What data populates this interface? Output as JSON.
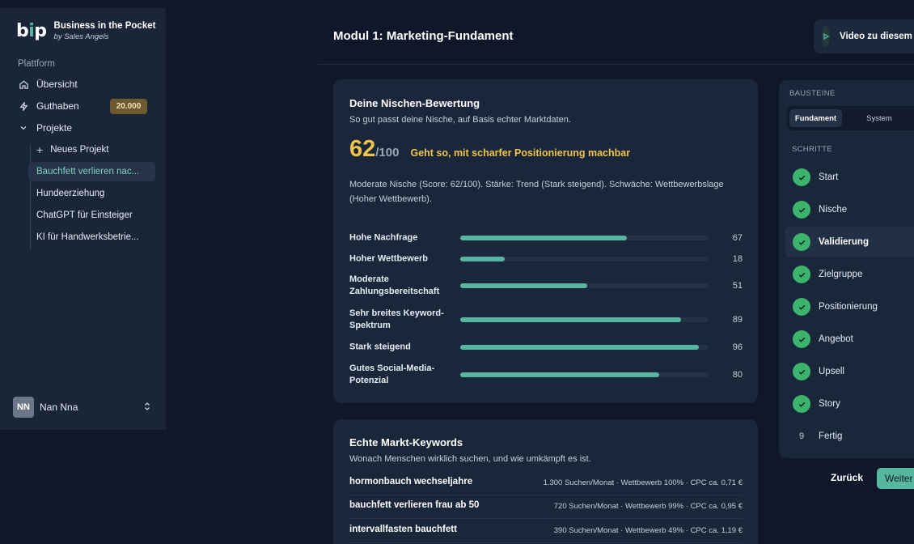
{
  "brand": {
    "mark_b": "b",
    "mark_i": "i",
    "mark_p": "p",
    "title": "Business in the Pocket",
    "subtitle": "by Sales Angels"
  },
  "sidebar": {
    "section": "Plattform",
    "overview": "Übersicht",
    "credits": "Guthaben",
    "credits_badge": "20.000",
    "projects": "Projekte",
    "new_project": "Neues Projekt",
    "project_items": [
      "Bauchfett verlieren nac...",
      "Hundeerziehung",
      "ChatGPT für Einsteiger",
      "KI für Handwerksbetrie..."
    ],
    "user_initials": "NN",
    "user_name": "Nan Nna"
  },
  "header": {
    "title": "Modul 1: Marketing-Fundament",
    "video_button": "Video zu diesem Modul"
  },
  "niche": {
    "title": "Deine Nischen-Bewertung",
    "subtitle": "So gut passt deine Nische, auf Basis echter Marktdaten.",
    "score": "62",
    "score_max": "/100",
    "verdict": "Geht so, mit scharfer Positionierung machbar",
    "summary": "Moderate Nische (Score: 62/100). Stärke: Trend (Stark steigend). Schwäche: Wettbewerbslage (Hoher Wettbewerb).",
    "metrics": [
      {
        "label": "Hohe Nachfrage",
        "value": 67
      },
      {
        "label": "Hoher Wettbewerb",
        "value": 18
      },
      {
        "label": "Moderate Zahlungsbereitschaft",
        "value": 51
      },
      {
        "label": "Sehr breites Keyword-Spektrum",
        "value": 89
      },
      {
        "label": "Stark steigend",
        "value": 96
      },
      {
        "label": "Gutes Social-Media-Potenzial",
        "value": 80
      }
    ]
  },
  "keywords": {
    "title": "Echte Markt-Keywords",
    "subtitle": "Wonach Menschen wirklich suchen, und wie umkämpft es ist.",
    "rows": [
      {
        "term": "hormonbauch wechseljahre",
        "meta": "1.300 Suchen/Monat · Wettbewerb 100% · CPC ca. 0,71 €"
      },
      {
        "term": "bauchfett verlieren frau ab 50",
        "meta": "720 Suchen/Monat · Wettbewerb 99% · CPC ca. 0,95 €"
      },
      {
        "term": "intervallfasten bauchfett",
        "meta": "390 Suchen/Monat · Wettbewerb 49% · CPC ca. 1,19 €"
      }
    ]
  },
  "panel": {
    "bausteine_label": "BAUSTEINE",
    "tab_fundament": "Fundament",
    "tab_system": "System",
    "schritte_label": "SCHRITTE",
    "steps": [
      {
        "label": "Start",
        "done": true
      },
      {
        "label": "Nische",
        "done": true
      },
      {
        "label": "Validierung",
        "done": true
      },
      {
        "label": "Zielgruppe",
        "done": true
      },
      {
        "label": "Positionierung",
        "done": true
      },
      {
        "label": "Angebot",
        "done": true
      },
      {
        "label": "Upsell",
        "done": true
      },
      {
        "label": "Story",
        "done": true
      },
      {
        "label": "Fertig",
        "done": false,
        "number": "9"
      }
    ]
  },
  "footer": {
    "back": "Zurück",
    "next": "Weiter"
  },
  "colors": {
    "accent": "#57b6a0",
    "score": "#f0c44b",
    "check": "#3cb46e"
  }
}
